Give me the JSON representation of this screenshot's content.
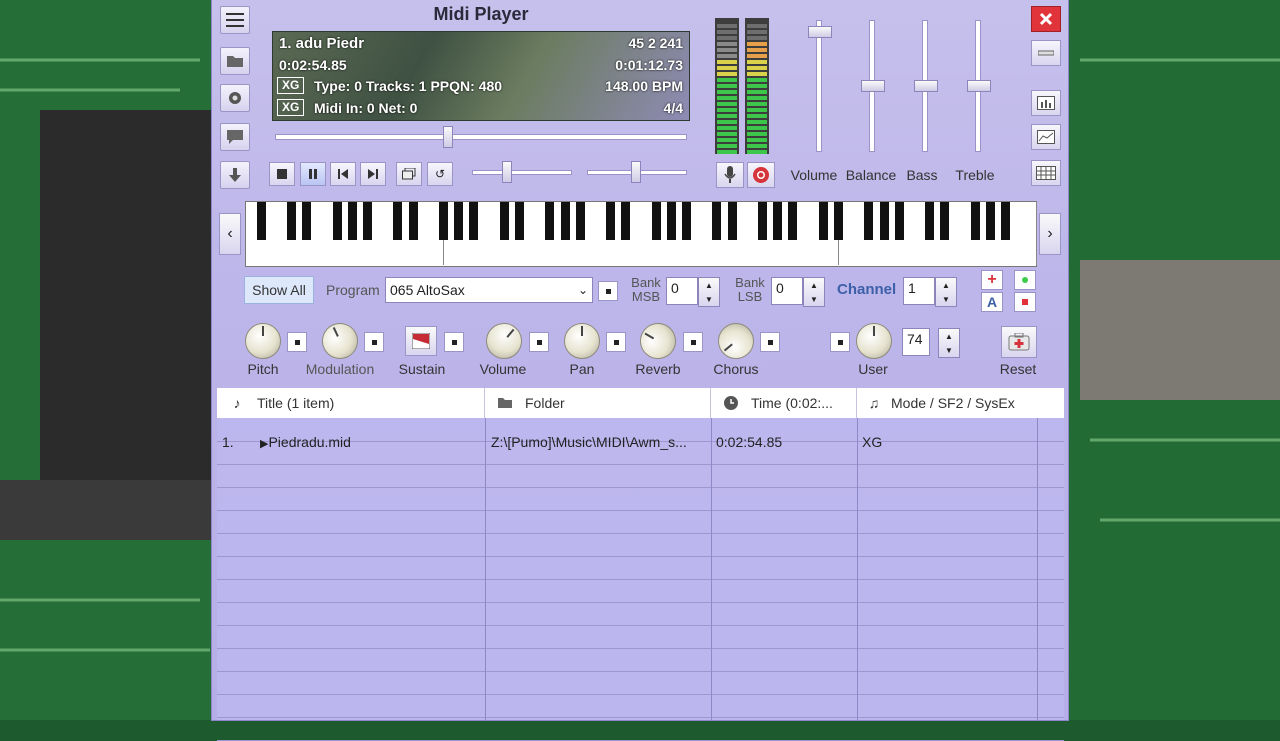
{
  "window": {
    "title": "Midi Player"
  },
  "display": {
    "track_name": "1. adu   Piedr",
    "elapsed": "0:02:54.85",
    "counters": "45   2  241",
    "remaining": "0:01:12.73",
    "xg_label_1": "XG",
    "type_info": "Type: 0 Tracks: 1 PPQN: 480",
    "tempo": "148.00 BPM",
    "xg_label_2": "XG",
    "midi_info": "Midi In: 0  Net: 0",
    "time_signature": "4/4",
    "seek_progress": 0.42
  },
  "sliders": {
    "labels": [
      "Volume",
      "Balance",
      "Bass",
      "Treble"
    ],
    "levels": [
      0.95,
      0.5,
      0.5,
      0.5
    ]
  },
  "controls": {
    "show_all": "Show All",
    "program_label": "Program",
    "program_value": "065 AltoSax",
    "bank_msb_label_1": "Bank",
    "bank_msb_label_2": "MSB",
    "bank_msb_value": "0",
    "bank_lsb_label_1": "Bank",
    "bank_lsb_label_2": "LSB",
    "bank_lsb_value": "0",
    "channel_label": "Channel",
    "channel_value": "1",
    "a_label": "A"
  },
  "knobs": {
    "pitch": "Pitch",
    "modulation": "Modulation",
    "sustain": "Sustain",
    "volume": "Volume",
    "pan": "Pan",
    "reverb": "Reverb",
    "chorus": "Chorus",
    "user": "User",
    "user_value": "74",
    "reset": "Reset"
  },
  "playlist": {
    "columns": {
      "title": "Title (1 item)",
      "folder": "Folder",
      "time": "Time (0:02:...",
      "mode": "Mode / SF2 / SysEx"
    },
    "rows": [
      {
        "index": "1.",
        "title": "Piedradu.mid",
        "folder": "Z:\\[Pumo]\\Music\\MIDI\\Awm_s...",
        "time": "0:02:54.85",
        "mode": "XG"
      }
    ]
  },
  "colors": {
    "panel": "#bdb6ea",
    "accent_channel": "#3d5fa8",
    "close": "#e0333a"
  }
}
